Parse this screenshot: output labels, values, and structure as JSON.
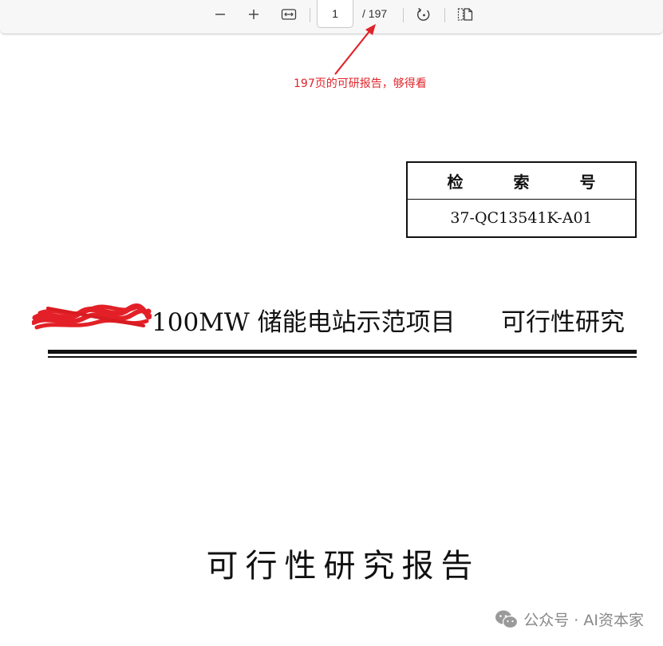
{
  "toolbar": {
    "zoom_out_icon": "minus-icon",
    "zoom_in_icon": "plus-icon",
    "fit_width_icon": "fit-width-icon",
    "current_page": "1",
    "page_total": "/ 197",
    "rotate_icon": "rotate-icon",
    "two_page_icon": "page-view-icon"
  },
  "annotation": {
    "text": "197页的可研报告，够得看",
    "color": "#e0232a"
  },
  "document": {
    "index_label": "检 索 号",
    "index_number": "37-QC13541K-A01",
    "title_main": "100MW 储能电站示范项目",
    "title_sub": "可行性研究",
    "report_title": "可行性研究报告"
  },
  "watermark": {
    "icon": "wechat-icon",
    "text": "公众号 · AI资本家"
  }
}
